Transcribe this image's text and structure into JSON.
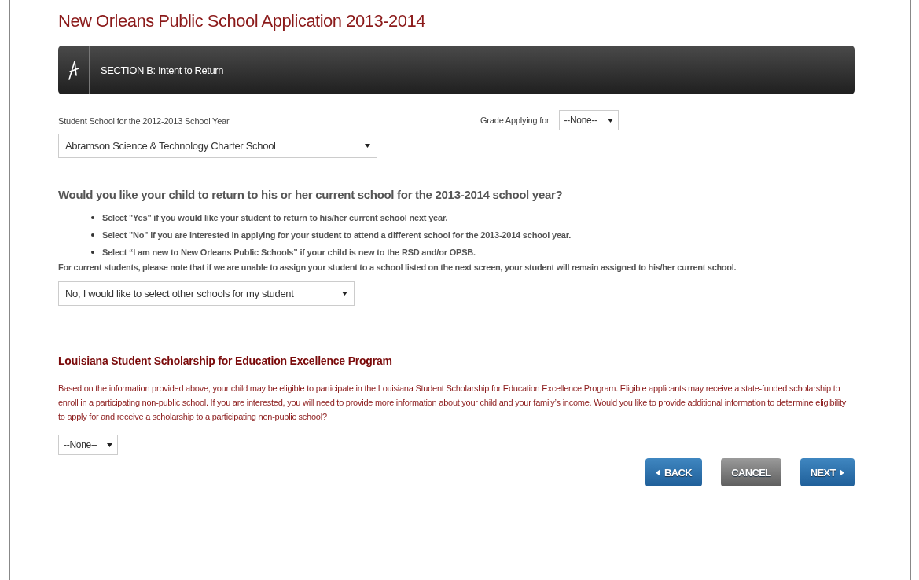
{
  "title": "New Orleans Public School Application 2013-2014",
  "section_header": {
    "title": "SECTION B: Intent to Return"
  },
  "school_field": {
    "label": "Student School for the 2012-2013 School Year",
    "value": "Abramson Science & Technology Charter School"
  },
  "grade_field": {
    "label": "Grade Applying for",
    "value": "--None--"
  },
  "question": "Would you like your child to return to his or her current school for the 2013-2014 school year?",
  "instructions": [
    "Select \"Yes\" if you would like your student to return to his/her current school next year.",
    "Select \"No\" if you are interested in applying for your student to attend a different school for the 2013-2014 school year.",
    "Select “I am new to New Orleans Public Schools” if your child is new to the RSD and/or OPSB."
  ],
  "note": "For current students, please note that if we are unable to assign your student to a school listed on the next screen, your student will remain assigned to his/her current school.",
  "return_field": {
    "value": "No, I would like to select other schools for my student"
  },
  "scholarship": {
    "heading": "Louisiana Student Scholarship for Education Excellence Program",
    "text": "Based on the information provided above, your child may be eligible to participate in the Louisiana Student Scholarship for Education Excellence Program. Eligible applicants may receive a state-funded scholarship to enroll in a participating non-public school. If you are interested, you will need to provide more information about your child and your family’s income. Would you like to provide additional information to determine eligibility to apply for and receive a scholarship to a participating non-public school?",
    "field": {
      "value": "--None--"
    }
  },
  "buttons": [
    {
      "label": "BACK",
      "kind": "back"
    },
    {
      "label": "CANCEL",
      "kind": "cancel"
    },
    {
      "label": "NEXT",
      "kind": "next"
    }
  ]
}
